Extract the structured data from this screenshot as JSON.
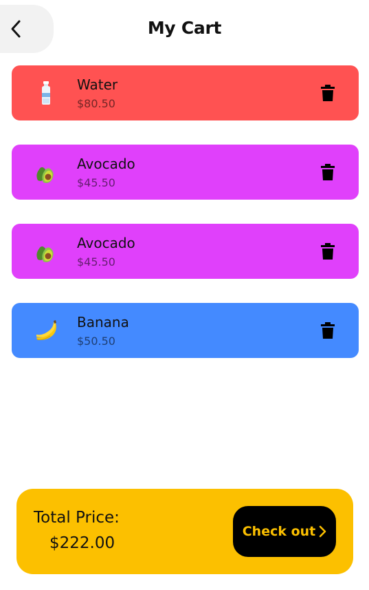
{
  "header": {
    "title": "My Cart",
    "back_icon": "chevron-left-icon"
  },
  "cart": {
    "items": [
      {
        "name": "Water",
        "price": "$80.50",
        "color": "#ff5252",
        "icon": "water-bottle-icon"
      },
      {
        "name": "Avocado",
        "price": "$45.50",
        "color": "#e040fb",
        "icon": "avocado-icon"
      },
      {
        "name": "Avocado",
        "price": "$45.50",
        "color": "#e040fb",
        "icon": "avocado-icon"
      },
      {
        "name": "Banana",
        "price": "$50.50",
        "color": "#448aff",
        "icon": "banana-icon"
      }
    ],
    "delete_icon": "trash-icon"
  },
  "footer": {
    "total_label": "Total Price:",
    "total_value": "$222.00",
    "checkout_label": "Check out",
    "accent_color": "#fcc000"
  }
}
